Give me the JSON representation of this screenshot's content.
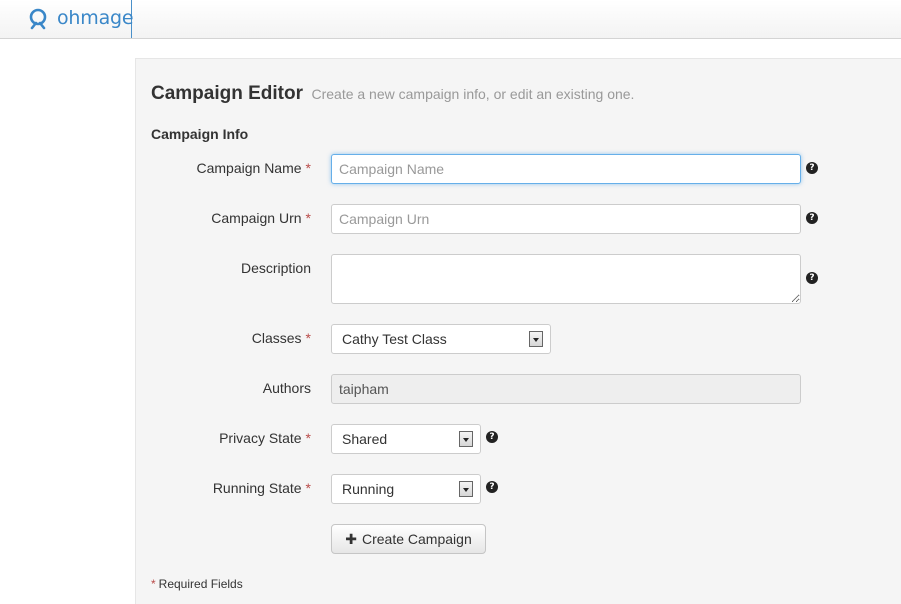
{
  "app": {
    "logo_text": "ohmage"
  },
  "colors": {
    "accent": "#3a87c8",
    "required": "#b94a48",
    "panel": "#f5f5f5"
  },
  "editor": {
    "title": "Campaign Editor",
    "subtitle": "Create a new campaign info, or edit an existing one.",
    "section": "Campaign Info",
    "required_marker": "*",
    "help_icon": "?",
    "fields": {
      "name": {
        "label": "Campaign Name",
        "placeholder": "Campaign Name",
        "value": ""
      },
      "urn": {
        "label": "Campaign Urn",
        "placeholder": "Campaign Urn",
        "value": ""
      },
      "description": {
        "label": "Description",
        "value": ""
      },
      "classes": {
        "label": "Classes",
        "selected": "Cathy Test Class"
      },
      "authors": {
        "label": "Authors",
        "value": "taipham"
      },
      "privacy": {
        "label": "Privacy State",
        "selected": "Shared"
      },
      "running": {
        "label": "Running State",
        "selected": "Running"
      }
    },
    "create_button": {
      "icon": "plus-icon",
      "label": "Create Campaign"
    },
    "footnote": "Required Fields"
  }
}
